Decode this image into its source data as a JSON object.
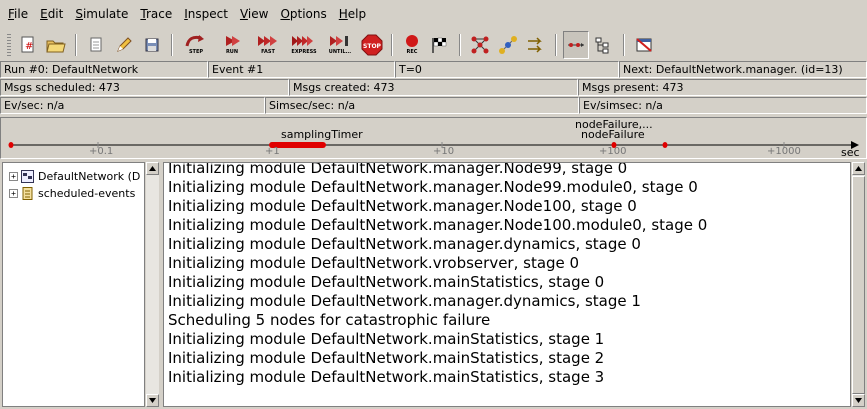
{
  "menu": [
    {
      "ul": "F",
      "rest": "ile"
    },
    {
      "ul": "E",
      "rest": "dit"
    },
    {
      "ul": "S",
      "rest": "imulate"
    },
    {
      "ul": "T",
      "rest": "race"
    },
    {
      "ul": "I",
      "rest": "nspect"
    },
    {
      "ul": "V",
      "rest": "iew"
    },
    {
      "ul": "O",
      "rest": "ptions"
    },
    {
      "ul": "H",
      "rest": "elp"
    }
  ],
  "toolbar": {
    "step": "STEP",
    "run": "RUN",
    "fast": "FAST",
    "express": "EXPRESS",
    "until": "UNTIL...",
    "stop": "STOP",
    "rec": "REC"
  },
  "status": {
    "run": "Run #0: DefaultNetwork",
    "event": "Event #1",
    "time": "T=0",
    "next": "Next: DefaultNetwork.manager. (id=13)",
    "msgs_scheduled": "Msgs scheduled: 473",
    "msgs_created": "Msgs created: 473",
    "msgs_present": "Msgs present: 473",
    "ev_sec": "Ev/sec: n/a",
    "simsec_sec": "Simsec/sec: n/a",
    "ev_simsec": "Ev/simsec: n/a"
  },
  "timeline": {
    "ticks": [
      "+0.1",
      "+1",
      "+10",
      "+100",
      "+1000"
    ],
    "unit": "sec",
    "label_sampling": "samplingTimer",
    "label_node1": "nodeFailure,...",
    "label_node2": "nodeFailure"
  },
  "tree": {
    "items": [
      {
        "label": "DefaultNetwork (D",
        "icon": "network-icon"
      },
      {
        "label": "scheduled-events",
        "icon": "queue-icon"
      }
    ]
  },
  "log": {
    "lines": [
      "Initializing module DefaultNetwork.manager.Node99, stage 0",
      "Initializing module DefaultNetwork.manager.Node99.module0, stage 0",
      "Initializing module DefaultNetwork.manager.Node100, stage 0",
      "Initializing module DefaultNetwork.manager.Node100.module0, stage 0",
      "Initializing module DefaultNetwork.manager.dynamics, stage 0",
      "Initializing module DefaultNetwork.vrobserver, stage 0",
      "Initializing module DefaultNetwork.mainStatistics, stage 0",
      "Initializing module DefaultNetwork.manager.dynamics, stage 1",
      "Scheduling 5 nodes for catastrophic failure",
      "Initializing module DefaultNetwork.mainStatistics, stage 1",
      "Initializing module DefaultNetwork.mainStatistics, stage 2",
      "Initializing module DefaultNetwork.mainStatistics, stage 3"
    ]
  },
  "colors": {
    "background": "#d4d0c8",
    "event_marker": "#e00000",
    "log_text": "#000000"
  }
}
